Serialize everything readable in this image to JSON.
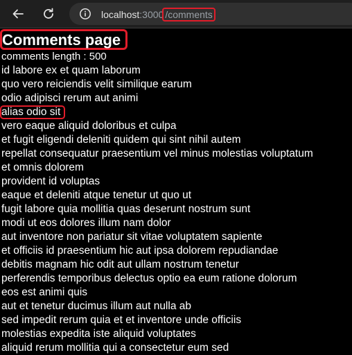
{
  "browser": {
    "url_host": "localhost",
    "url_port": ":3000",
    "url_separator": "/",
    "url_path": "comments",
    "back_icon": "back-arrow-icon",
    "reload_icon": "reload-icon",
    "info_icon": "info-icon",
    "annotation_color": "#e11d2a"
  },
  "page": {
    "title": "Comments page",
    "comments_length": "comments length : 500"
  },
  "comments": [
    "id labore ex et quam laborum",
    "quo vero reiciendis velit similique earum",
    "odio adipisci rerum aut animi",
    "alias odio sit",
    "vero eaque aliquid doloribus et culpa",
    "et fugit eligendi deleniti quidem qui sint nihil autem",
    "repellat consequatur praesentium vel minus molestias voluptatum",
    "et omnis dolorem",
    "provident id voluptas",
    "eaque et deleniti atque tenetur ut quo ut",
    "fugit labore quia mollitia quas deserunt nostrum sunt",
    "modi ut eos dolores illum nam dolor",
    "aut inventore non pariatur sit vitae voluptatem sapiente",
    "et officiis id praesentium hic aut ipsa dolorem repudiandae",
    "debitis magnam hic odit aut ullam nostrum tenetur",
    "perferendis temporibus delectus optio ea eum ratione dolorum",
    "eos est animi quis",
    "aut et tenetur ducimus illum aut nulla ab",
    "sed impedit rerum quia et et inventore unde officiis",
    "molestias expedita iste aliquid voluptates",
    "aliquid rerum mollitia qui a consectetur eum sed"
  ]
}
